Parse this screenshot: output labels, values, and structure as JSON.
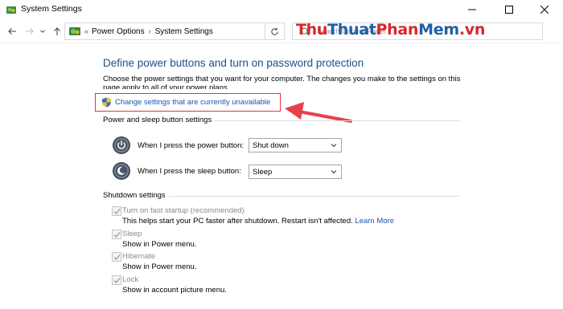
{
  "window": {
    "title": "System Settings",
    "minimize": "—",
    "maximize": "☐",
    "close": "✕"
  },
  "navigation": {
    "back_icon": "arrow-left-icon",
    "forward_icon": "arrow-right-icon",
    "history_icon": "chevron-down-icon",
    "up_icon": "arrow-up-icon",
    "breadcrumb_overflow": "«",
    "breadcrumbs": [
      "Power Options",
      "System Settings"
    ],
    "search_placeholder": "Search Control Panel"
  },
  "watermark": {
    "part1": "Thu",
    "part2": "Thuat",
    "part3": "Phan",
    "part4": "Mem",
    "part5": ".vn"
  },
  "page": {
    "heading": "Define power buttons and turn on password protection",
    "description_line1": "Choose the power settings that you want for your computer. The changes you make to the settings on this",
    "description_line2": "page apply to all of your power plans.",
    "change_settings_link": "Change settings that are currently unavailable"
  },
  "power_buttons": {
    "section_title": "Power and sleep button settings",
    "power_label": "When I press the power button:",
    "power_value": "Shut down",
    "sleep_label": "When I press the sleep button:",
    "sleep_value": "Sleep"
  },
  "shutdown": {
    "section_title": "Shutdown settings",
    "items": [
      {
        "title": "Turn on fast startup (recommended)",
        "description": "This helps start your PC faster after shutdown. Restart isn't affected.",
        "link": "Learn More",
        "checked": true
      },
      {
        "title": "Sleep",
        "description": "Show in Power menu.",
        "checked": true
      },
      {
        "title": "Hibernate",
        "description": "Show in Power menu.",
        "checked": true
      },
      {
        "title": "Lock",
        "description": "Show in account picture menu.",
        "checked": true
      }
    ]
  },
  "colors": {
    "heading_blue": "#1e4e8c",
    "link_blue": "#1a56b0",
    "annotation_red": "#e0363b"
  }
}
